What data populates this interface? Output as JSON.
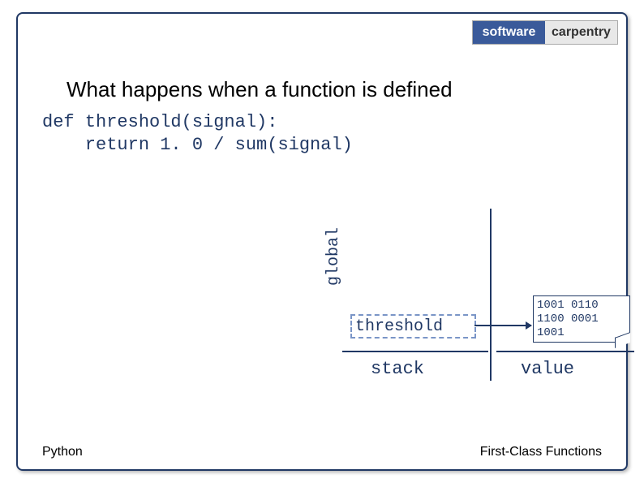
{
  "logo": {
    "left": "software",
    "right": "carpentry"
  },
  "heading": "What happens when a function is defined",
  "code": {
    "line1": "def threshold(signal):",
    "line2": "    return 1. 0 / sum(signal)"
  },
  "diagram": {
    "vertical_label": "global",
    "stack_item": "threshold",
    "value_box": "1001 0110\n1100 0001\n1001",
    "stack_label": "stack",
    "value_label": "value"
  },
  "footer": {
    "left": "Python",
    "right": "First-Class Functions"
  }
}
